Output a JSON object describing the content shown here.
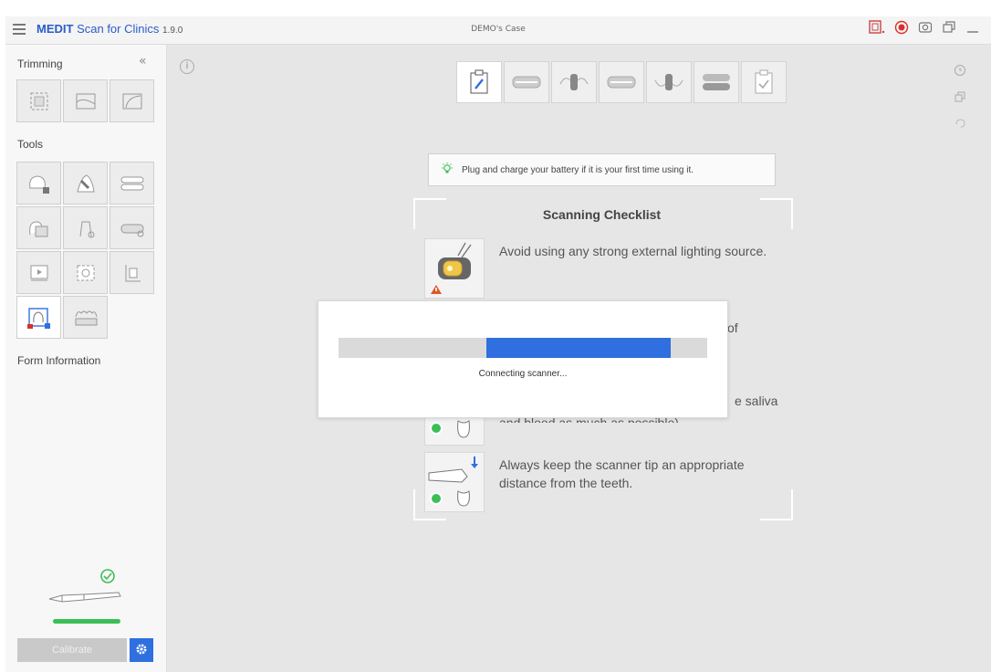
{
  "app": {
    "brand": "MEDIT",
    "product": "Scan for Clinics",
    "version": "1.9.0",
    "case_name": "DEMO's Case"
  },
  "colors": {
    "accent": "#2f6fe0",
    "success": "#3bbf55",
    "record": "#d9302a",
    "warning": "#e0572a"
  },
  "sidebar": {
    "trimming_title": "Trimming",
    "collapse_glyph": "«",
    "tools_title": "Tools",
    "form_info": "Form Information",
    "calibrate_label": "Calibrate"
  },
  "main": {
    "info_glyph": "i",
    "tip": "Plug and charge your battery if it is your first time using it.",
    "checklist_title": "Scanning Checklist",
    "items": [
      {
        "text": "Avoid using any strong external lighting source."
      },
      {
        "text": "of"
      },
      {
        "text": "e saliva"
      },
      {
        "text": "Always keep the scanner tip an appropriate distance from the teeth."
      }
    ],
    "partial_line": "and blood as much as possible)."
  },
  "modal": {
    "status": "Connecting scanner...",
    "progress_start": 0.4,
    "progress_end": 0.9
  }
}
